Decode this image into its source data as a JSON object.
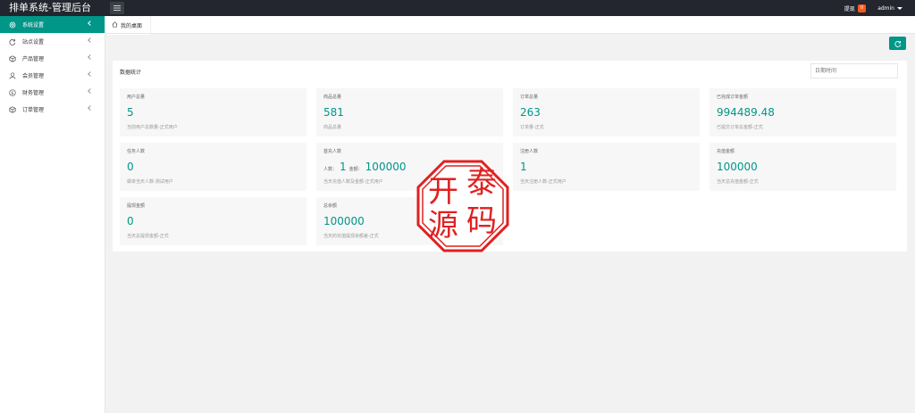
{
  "header": {
    "title": "排单系统-管理后台",
    "notify_label": "提现",
    "notify_count": "0",
    "user": "admin"
  },
  "sidebar": {
    "items": [
      {
        "label": "系统设置",
        "icon": "gear-icon",
        "active": true
      },
      {
        "label": "站点设置",
        "icon": "refresh-icon",
        "active": false
      },
      {
        "label": "产品管理",
        "icon": "box-icon",
        "active": false
      },
      {
        "label": "会员管理",
        "icon": "user-icon",
        "active": false
      },
      {
        "label": "财务管理",
        "icon": "dollar-icon",
        "active": false
      },
      {
        "label": "订单管理",
        "icon": "box-icon",
        "active": false
      }
    ]
  },
  "tabs": [
    {
      "label": "我的桌面",
      "icon": "home-icon"
    }
  ],
  "panel": {
    "title": "数据统计",
    "date_placeholder": "日期时间"
  },
  "cards": [
    {
      "label": "用户总量",
      "value": "5",
      "sub": "当前用户总数量-正式用户"
    },
    {
      "label": "商品总量",
      "value": "581",
      "sub": "商品总量"
    },
    {
      "label": "订单总量",
      "value": "263",
      "sub": "订单量-正式"
    },
    {
      "label": "已完成订单金额",
      "value": "994489.48",
      "sub": "已提交订单总金额-正式"
    },
    {
      "label": "任务人数",
      "value": "0",
      "sub": "做单当天人数-测试用户"
    },
    {
      "label": "首充人数",
      "count_label": "人数：",
      "count": "1",
      "amount_label": "金额：",
      "amount": "100000",
      "sub": "当天充值人数及金额-正式用户"
    },
    {
      "label": "注册人数",
      "value": "1",
      "sub": "当天注册人数-正式用户"
    },
    {
      "label": "充值金额",
      "value": "100000",
      "sub": "当天总充值金额-正式"
    },
    {
      "label": "提现金额",
      "value": "0",
      "sub": "当天总提现金额-正式"
    },
    {
      "label": "总余额",
      "value": "100000",
      "sub": "当天的充值提现余额差-正式"
    }
  ],
  "watermark": {
    "text": "开泰源码",
    "color": "#e02020"
  },
  "colors": {
    "accent": "#009688",
    "header": "#23262e",
    "badge": "#ff5722"
  }
}
